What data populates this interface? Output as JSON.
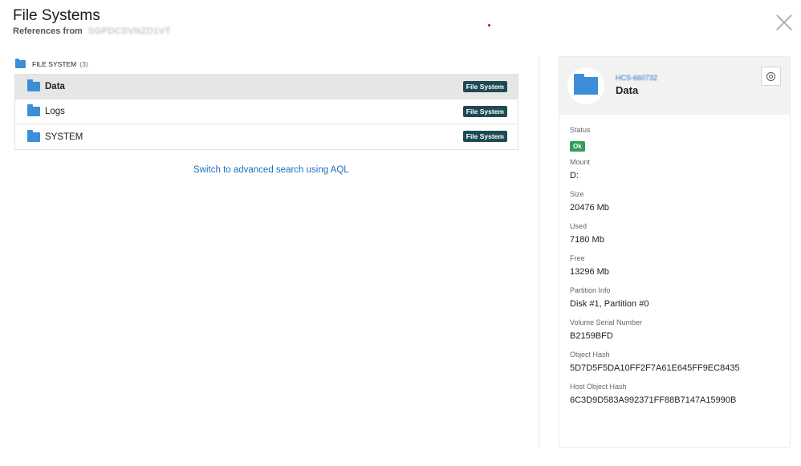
{
  "header": {
    "title": "File Systems",
    "references_label": "References from",
    "references_value": "SGPDCSVNZD1VT"
  },
  "section": {
    "label": "FILE SYSTEM",
    "count": "(3)"
  },
  "list": {
    "items": [
      {
        "name": "Data",
        "badge": "File System",
        "selected": true
      },
      {
        "name": "Logs",
        "badge": "File System",
        "selected": false
      },
      {
        "name": "SYSTEM",
        "badge": "File System",
        "selected": false
      }
    ]
  },
  "aql_link": "Switch to advanced search using AQL",
  "detail": {
    "code": "HCS-660732",
    "name": "Data",
    "properties": {
      "status_label": "Status",
      "status_value": "Ok",
      "mount_label": "Mount",
      "mount_value": "D:",
      "size_label": "Size",
      "size_value": "20476 Mb",
      "used_label": "Used",
      "used_value": "7180 Mb",
      "free_label": "Free",
      "free_value": "13296 Mb",
      "partition_label": "Partition Info",
      "partition_value": "Disk #1, Partition #0",
      "serial_label": "Volume Serial Number",
      "serial_value": "B2159BFD",
      "hash_label": "Object Hash",
      "hash_value": "5D7D5F5DA10FF2F7A61E645FF9EC8435",
      "host_hash_label": "Host Object Hash",
      "host_hash_value": "6C3D9D583A992371FF88B7147A15990B"
    }
  },
  "colors": {
    "accent_link": "#1f6fc2",
    "folder": "#3d8ed9",
    "badge_bg": "#1e4a54",
    "status_ok": "#2e9e5b"
  },
  "icons": {
    "close": "close-icon",
    "folder": "folder-icon",
    "settings": "settings-icon"
  }
}
